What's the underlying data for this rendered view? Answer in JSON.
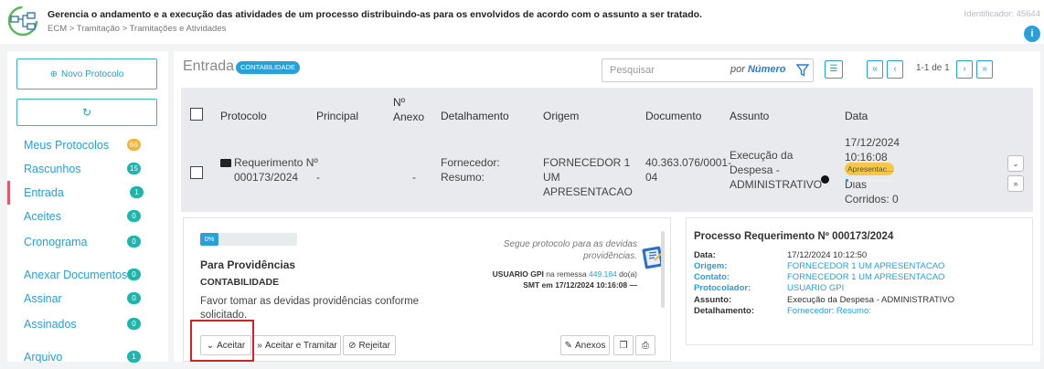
{
  "header": {
    "description": "Gerencia o andamento e a execução das atividades de um processo distribuindo-as para os envolvidos de acordo com o assunto a ser tratado.",
    "breadcrumb": "ECM > Tramitação > Tramitações e Atividades",
    "identifier": "Identificador: 45644",
    "info_icon": "info-icon"
  },
  "sidebar": {
    "novo_protocolo": "Novo Protocolo",
    "items": [
      {
        "label": "Meus Protocolos",
        "count": "66",
        "color": "#f0b43c"
      },
      {
        "label": "Rascunhos",
        "count": "15",
        "color": "#1fb5ad"
      },
      {
        "label": "Entrada",
        "count": "1",
        "color": "#1fb5ad",
        "active": true
      },
      {
        "label": "Aceites",
        "count": "0",
        "color": "#1fb5ad"
      },
      {
        "label": "Cronograma",
        "count": "0",
        "color": "#1fb5ad"
      },
      {
        "label": "Anexar Documentos",
        "count": "0",
        "color": "#1fb5ad"
      },
      {
        "label": "Assinar",
        "count": "0",
        "color": "#1fb5ad"
      },
      {
        "label": "Assinados",
        "count": "0",
        "color": "#1fb5ad"
      },
      {
        "label": "Arquivo",
        "count": "1",
        "color": "#1fb5ad"
      }
    ]
  },
  "toolbar": {
    "title": "Entrada",
    "badge": "CONTABILIDADE",
    "search_placeholder": "Pesquisar",
    "search_prefix": "por",
    "search_mode": "Número",
    "pagination": "1-1 de 1",
    "first": "«",
    "prev": "‹",
    "next": "›",
    "last": "»"
  },
  "table": {
    "headers": [
      "Protocolo",
      "Principal",
      "Nº Anexo",
      "Detalhamento",
      "Origem",
      "Documento",
      "Assunto",
      "Data"
    ],
    "row": {
      "protocolo": "Requerimento Nº 000173/2024",
      "principal": "-",
      "anexo": "-",
      "detalhamento": "Fornecedor: Resumo:",
      "origem": "FORNECEDOR 1 UM APRESENTACAO",
      "documento": "40.363.076/0001-04",
      "assunto": "Execução da Despesa - ADMINISTRATIVO",
      "data": "17/12/2024 10:16:08",
      "dias": "Dias Corridos: 0",
      "status": "Apresentac..."
    }
  },
  "detail": {
    "progress": "0%",
    "title": "Para Providências",
    "dept": "CONTABILIDADE",
    "message": "Favor tomar as devidas providências conforme solicitado.",
    "note": "Segue protocolo para as devidas providências.",
    "meta_user": "USUARIO GPI",
    "meta_text": "na remessa",
    "meta_remessa": "449.184",
    "meta_suffix": "do(a)",
    "meta_line2": "SMT em 17/12/2024 10:16:08 —",
    "buttons": {
      "aceitar": "Aceitar",
      "aceitar_tramitar": "Aceitar e Tramitar",
      "rejeitar": "Rejeitar",
      "anexos": "Anexos"
    }
  },
  "processo": {
    "title": "Processo Requerimento Nº 000173/2024",
    "fields": [
      {
        "label": "Data:",
        "value": "17/12/2024 10:12:50",
        "blue_label": false,
        "blue_value": false
      },
      {
        "label": "Origem:",
        "value": "FORNECEDOR 1 UM APRESENTACAO",
        "blue_label": true,
        "blue_value": true
      },
      {
        "label": "Contato:",
        "value": "FORNECEDOR 1 UM APRESENTACAO",
        "blue_label": true,
        "blue_value": true
      },
      {
        "label": "Protocolador:",
        "value": "USUARIO GPI",
        "blue_label": true,
        "blue_value": true
      },
      {
        "label": "Assunto:",
        "value": "Execução da Despesa - ADMINISTRATIVO",
        "blue_label": false,
        "blue_value": false
      },
      {
        "label": "Detalhamento:",
        "value": "Fornecedor: Resumo:",
        "blue_label": false,
        "blue_value": true
      }
    ]
  }
}
